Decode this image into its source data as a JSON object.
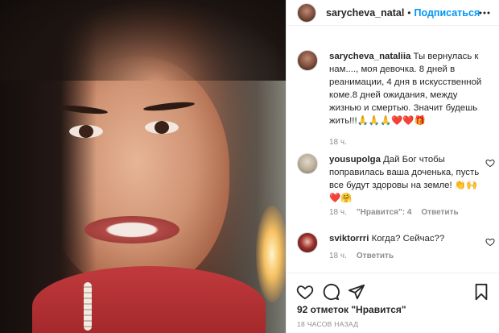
{
  "header": {
    "username": "sarycheva_natal",
    "separator": "•",
    "follow_label": "Подписаться"
  },
  "comments": [
    {
      "username": "sarycheva_nataliia",
      "text": "Ты вернулась к нам...., моя девочка. 8 дней в реанимации, 4 дня в искусственной коме.8 дней ожидания, между жизнью и смертью. Значит будешь жить!!!🙏🙏🙏❤️❤️🎁",
      "time": "18 ч."
    },
    {
      "username": "yousupolga",
      "text": "Дай Бог чтобы поправилась ваша доченька, пусть все будут здоровы на земле! 👏🙌❤️🤗",
      "time": "18 ч.",
      "likes": "\"Нравится\": 4",
      "reply": "Ответить"
    },
    {
      "username": "sviktorrri",
      "text": "Когда? Сейчас??",
      "time": "18 ч.",
      "reply": "Ответить"
    }
  ],
  "actions": {
    "like_icon": "heart-icon",
    "comment_icon": "comment-icon",
    "share_icon": "paper-plane-icon",
    "save_icon": "bookmark-icon"
  },
  "likes_text": "92 отметок \"Нравится\"",
  "time_ago": "18 ЧАСОВ НАЗАД",
  "colors": {
    "accent": "#0095f6",
    "text": "#262626",
    "muted": "#8e8e8e",
    "border": "#efefef"
  }
}
